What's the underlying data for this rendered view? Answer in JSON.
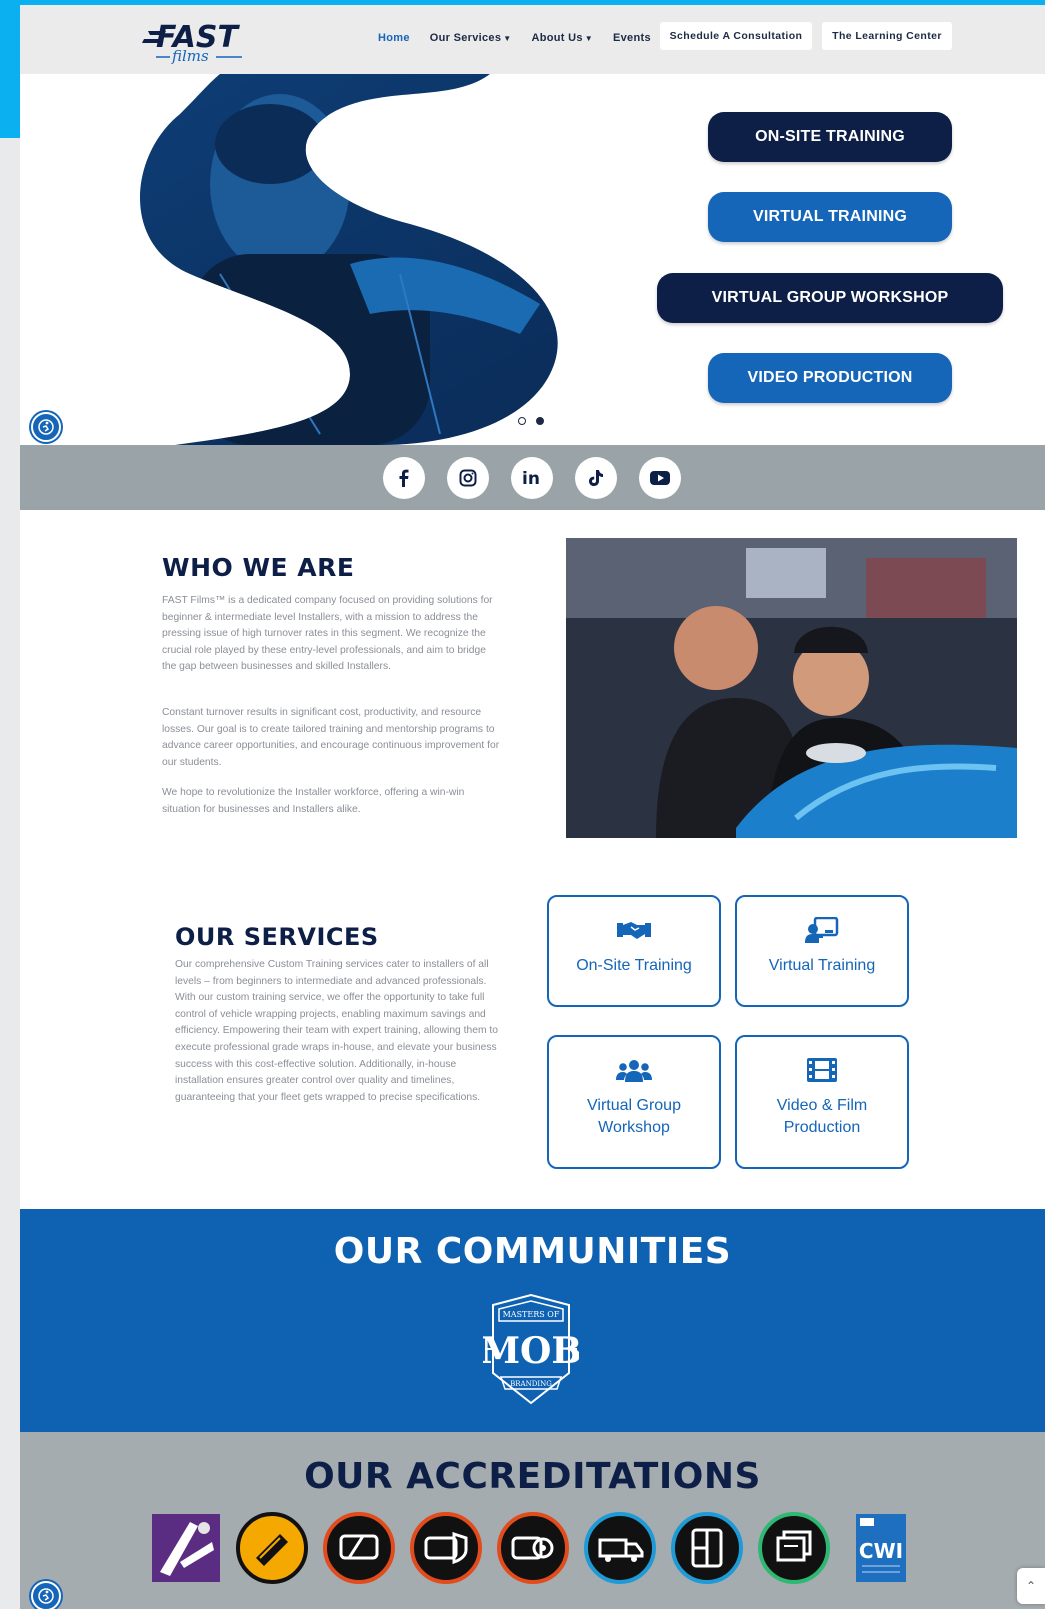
{
  "brand": {
    "logo_top": "FAST",
    "logo_bottom": "films",
    "accent": "#0ab0f0",
    "primary_blue": "#1565b9",
    "navy": "#0d1f47"
  },
  "nav": {
    "home": "Home",
    "services": "Our Services",
    "about": "About Us",
    "events": "Events",
    "consultation": "Schedule A Consultation",
    "learning": "The Learning Center"
  },
  "hero": {
    "buttons": {
      "onsite": "ON-SITE TRAINING",
      "virtual": "VIRTUAL TRAINING",
      "group": "VIRTUAL GROUP WORKSHOP",
      "video": "VIDEO PRODUCTION"
    },
    "slide_count": 2,
    "active_slide": 2
  },
  "social": [
    "facebook-icon",
    "instagram-icon",
    "linkedin-icon",
    "tiktok-icon",
    "youtube-icon"
  ],
  "who": {
    "title": "WHO WE ARE",
    "p1": "FAST Films™ is a dedicated company focused on providing solutions for beginner & intermediate level Installers, with a mission to address the pressing issue of high turnover rates in this segment. We recognize the crucial role played by these entry-level professionals, and aim to bridge the gap between businesses and skilled Installers.",
    "p2": "Constant turnover results in significant cost, productivity, and resource losses. Our goal is to create tailored training and mentorship programs to advance career opportunities, and encourage continuous improvement for our students.",
    "p3": "We hope to revolutionize the Installer workforce, offering a win-win situation for businesses and Installers alike."
  },
  "services": {
    "title": "OUR SERVICES",
    "body": "Our comprehensive Custom Training services cater to installers of all levels – from beginners to intermediate and advanced professionals. With our custom training service, we offer the opportunity to take full control of vehicle wrapping projects, enabling maximum savings and efficiency. Empowering their team with expert training, allowing them to execute professional grade wraps in-house, and elevate your business success with this cost-effective solution. Additionally, in-house installation ensures greater control over quality and timelines, guaranteeing that your fleet gets wrapped to precise specifications.",
    "cards": {
      "onsite": "On-Site Training",
      "virtual": "Virtual Training",
      "group": "Virtual Group Workshop",
      "video": "Video & Film Production"
    }
  },
  "communities": {
    "title": "OUR COMMUNITIES",
    "logo_text_top": "MASTERS OF",
    "logo_text_mid": "MOB",
    "logo_text_bottom": "BRANDING"
  },
  "accreditations": {
    "title": "OUR ACCREDITATIONS",
    "cwi": "CWI"
  }
}
